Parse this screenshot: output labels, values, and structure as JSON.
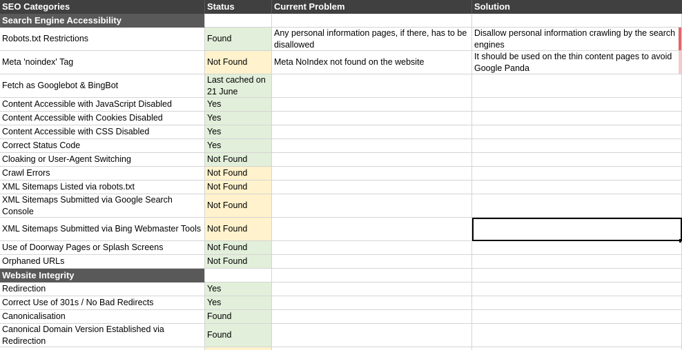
{
  "headers": {
    "category": "SEO Categories",
    "status": "Status",
    "problem": "Current Problem",
    "solution": "Solution"
  },
  "sections": [
    {
      "title": "Search Engine Accessibility"
    },
    {
      "title": "Website Integrity"
    }
  ],
  "rows": [
    {
      "category": "Robots.txt Restrictions",
      "status": "Found",
      "problem": "Any personal information pages, if there, has to be disallowed",
      "solution": "Disallow personal information crawling by the search engines"
    },
    {
      "category": "Meta 'noindex' Tag",
      "status": "Not Found",
      "problem": "Meta NoIndex not found on the website",
      "solution": "It should be used on the thin content pages to avoid Google Panda"
    },
    {
      "category": "Fetch as Googlebot & BingBot",
      "status": "Last cached on 21 June",
      "problem": "",
      "solution": ""
    },
    {
      "category": "Content Accessible with JavaScript Disabled",
      "status": "Yes",
      "problem": "",
      "solution": ""
    },
    {
      "category": "Content Accessible with Cookies Disabled",
      "status": "Yes",
      "problem": "",
      "solution": ""
    },
    {
      "category": "Content Accessible with CSS Disabled",
      "status": "Yes",
      "problem": "",
      "solution": ""
    },
    {
      "category": "Correct Status Code",
      "status": "Yes",
      "problem": "",
      "solution": ""
    },
    {
      "category": "Cloaking or User-Agent Switching",
      "status": "Not Found",
      "problem": "",
      "solution": ""
    },
    {
      "category": "Crawl Errors",
      "status": "Not Found",
      "problem": "",
      "solution": ""
    },
    {
      "category": "XML Sitemaps Listed via robots.txt",
      "status": "Not Found",
      "problem": "",
      "solution": ""
    },
    {
      "category": "XML Sitemaps Submitted via Google Search Console",
      "status": "Not Found",
      "problem": "",
      "solution": ""
    },
    {
      "category": "XML Sitemaps Submitted via Bing Webmaster Tools",
      "status": "Not Found",
      "problem": "",
      "solution": ""
    },
    {
      "category": "Use of Doorway Pages or Splash Screens",
      "status": "Not Found",
      "problem": "",
      "solution": ""
    },
    {
      "category": "Orphaned URLs",
      "status": "Not Found",
      "problem": "",
      "solution": ""
    },
    {
      "category": "Redirection",
      "status": "Yes",
      "problem": "",
      "solution": ""
    },
    {
      "category": "Correct Use of 301s / No Bad Redirects",
      "status": "Yes",
      "problem": "",
      "solution": ""
    },
    {
      "category": "Canonicalisation",
      "status": "Found",
      "problem": "",
      "solution": ""
    },
    {
      "category": "Canonical Domain Version Established via Redirection",
      "status": "Found",
      "problem": "",
      "solution": ""
    }
  ],
  "colors": {
    "header_bg": "#404040",
    "section_bg": "#595959",
    "status_green": "#e2efda",
    "status_yellow": "#fff2cc",
    "flag_red": "#e06666"
  }
}
